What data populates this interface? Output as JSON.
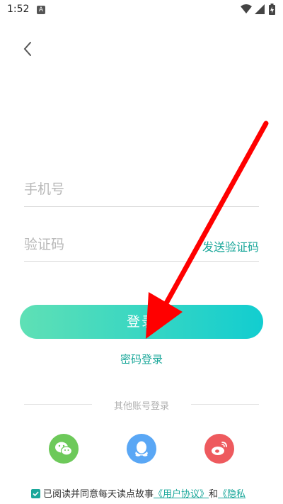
{
  "status": {
    "time": "1:52",
    "notif_letter": "A"
  },
  "form": {
    "phone_placeholder": "手机号",
    "code_placeholder": "验证码",
    "send_code_label": "发送验证码"
  },
  "buttons": {
    "login_label": "登录",
    "password_login_label": "密码登录"
  },
  "other_login": {
    "label": "其他账号登录",
    "providers": [
      "wechat",
      "qq",
      "weibo"
    ]
  },
  "agreement": {
    "prefix": "已阅读并同意每天读点故事",
    "user_agreement": "《用户协议》",
    "and": "和",
    "privacy": "《隐私"
  },
  "colors": {
    "accent": "#1aa79a",
    "gradient_start": "#5fe0b5",
    "gradient_end": "#12cdd0",
    "wechat": "#6dc95a",
    "qq": "#5aa7f5",
    "weibo": "#ee5a5e",
    "arrow": "#ff0000"
  },
  "icons": [
    "back-arrow-icon",
    "wifi-icon",
    "signal-icon",
    "battery-icon",
    "wechat-icon",
    "qq-icon",
    "weibo-icon",
    "checkbox-checked-icon"
  ]
}
